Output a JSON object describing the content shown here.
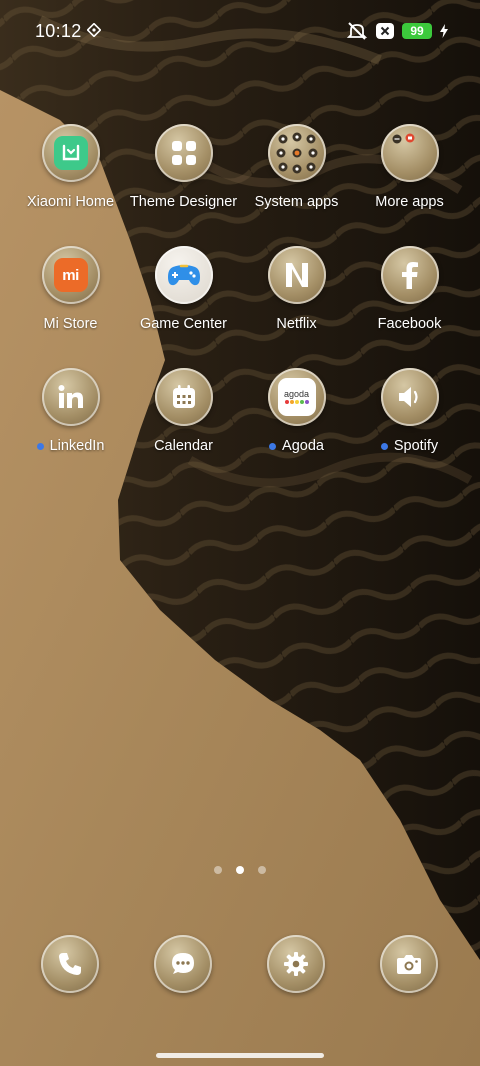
{
  "status_bar": {
    "time": "10:12",
    "battery_level": "99",
    "icons": [
      "location-diamond-icon",
      "silent-bell-icon",
      "close-box-icon",
      "charging-bolt-icon"
    ]
  },
  "apps": [
    {
      "label": "Xiaomi Home",
      "icon": "xiaomi-home-icon",
      "badge": false
    },
    {
      "label": "Theme Designer",
      "icon": "theme-grid-icon",
      "badge": false
    },
    {
      "label": "System apps",
      "icon": "folder-system-apps-icon",
      "badge": false
    },
    {
      "label": "More apps",
      "icon": "folder-more-apps-icon",
      "badge": false
    },
    {
      "label": "Mi Store",
      "icon": "mi-store-icon",
      "badge": false
    },
    {
      "label": "Game Center",
      "icon": "gamepad-icon",
      "badge": false
    },
    {
      "label": "Netflix",
      "icon": "netflix-icon",
      "badge": false
    },
    {
      "label": "Facebook",
      "icon": "facebook-icon",
      "badge": false
    },
    {
      "label": "LinkedIn",
      "icon": "linkedin-icon",
      "badge": true
    },
    {
      "label": "Calendar",
      "icon": "calendar-icon",
      "badge": false
    },
    {
      "label": "Agoda",
      "icon": "agoda-icon",
      "badge": true
    },
    {
      "label": "Spotify",
      "icon": "speaker-icon",
      "badge": true
    }
  ],
  "agoda_logo_text": "agoda",
  "mi_logo_text": "mi",
  "page_indicator": {
    "count": 3,
    "active_index": 1
  },
  "dock": [
    {
      "icon": "phone-icon"
    },
    {
      "icon": "messages-icon"
    },
    {
      "icon": "settings-gear-icon"
    },
    {
      "icon": "camera-icon"
    }
  ],
  "colors": {
    "battery": "#3cc93c",
    "notification_dot": "#3c78e6",
    "sand": "#a98858",
    "shadow": "#1a140c"
  }
}
